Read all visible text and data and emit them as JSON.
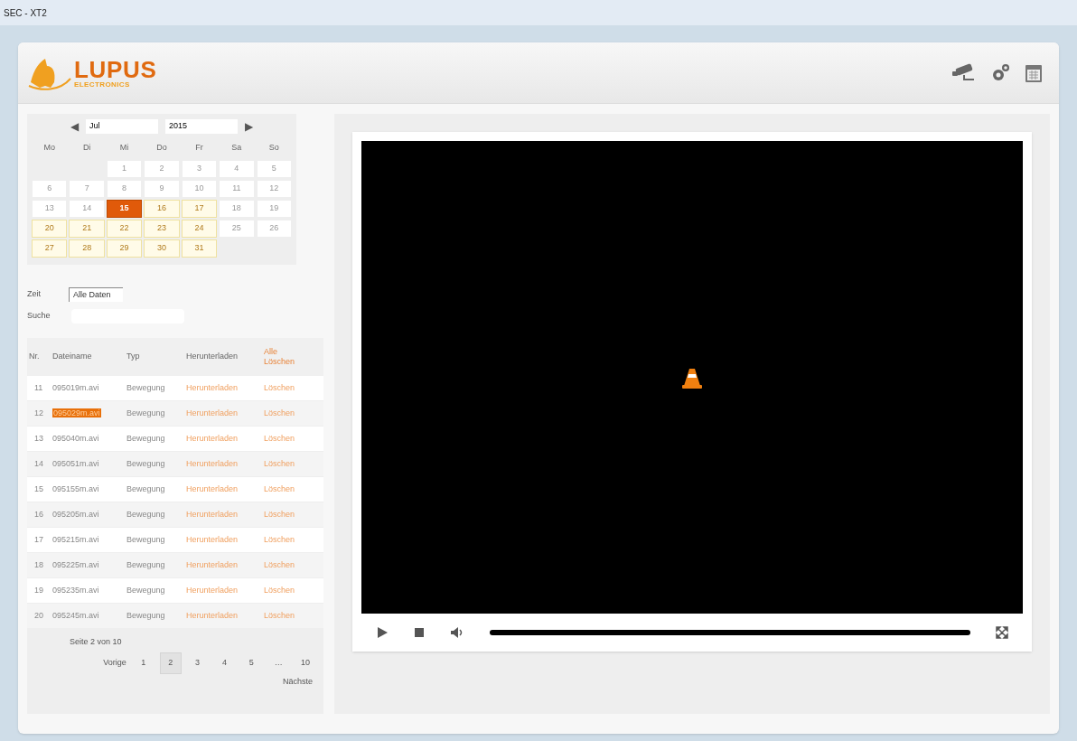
{
  "window": {
    "title": "SEC - XT2"
  },
  "logo": {
    "name": "LUPUS",
    "subtitle": "ELECTRONICS"
  },
  "calendar": {
    "month": "Jul",
    "year": "2015",
    "prev": "◀",
    "next": "▶",
    "weekdays": [
      "Mo",
      "Di",
      "Mi",
      "Do",
      "Fr",
      "Sa",
      "So"
    ],
    "days": [
      {
        "label": "1",
        "has_data": false,
        "selected": false
      },
      {
        "label": "2",
        "has_data": false,
        "selected": false
      },
      {
        "label": "3",
        "has_data": false,
        "selected": false
      },
      {
        "label": "4",
        "has_data": false,
        "selected": false
      },
      {
        "label": "5",
        "has_data": false,
        "selected": false
      },
      {
        "label": "6",
        "has_data": false,
        "selected": false
      },
      {
        "label": "7",
        "has_data": false,
        "selected": false
      },
      {
        "label": "8",
        "has_data": false,
        "selected": false
      },
      {
        "label": "9",
        "has_data": false,
        "selected": false
      },
      {
        "label": "10",
        "has_data": false,
        "selected": false
      },
      {
        "label": "11",
        "has_data": false,
        "selected": false
      },
      {
        "label": "12",
        "has_data": false,
        "selected": false
      },
      {
        "label": "13",
        "has_data": false,
        "selected": false
      },
      {
        "label": "14",
        "has_data": false,
        "selected": false
      },
      {
        "label": "15",
        "has_data": true,
        "selected": true
      },
      {
        "label": "16",
        "has_data": true,
        "selected": false
      },
      {
        "label": "17",
        "has_data": true,
        "selected": false
      },
      {
        "label": "18",
        "has_data": false,
        "selected": false
      },
      {
        "label": "19",
        "has_data": false,
        "selected": false
      },
      {
        "label": "20",
        "has_data": true,
        "selected": false
      },
      {
        "label": "21",
        "has_data": true,
        "selected": false
      },
      {
        "label": "22",
        "has_data": true,
        "selected": false
      },
      {
        "label": "23",
        "has_data": true,
        "selected": false
      },
      {
        "label": "24",
        "has_data": true,
        "selected": false
      },
      {
        "label": "25",
        "has_data": false,
        "selected": false
      },
      {
        "label": "26",
        "has_data": false,
        "selected": false
      },
      {
        "label": "27",
        "has_data": true,
        "selected": false
      },
      {
        "label": "28",
        "has_data": true,
        "selected": false
      },
      {
        "label": "29",
        "has_data": true,
        "selected": false
      },
      {
        "label": "30",
        "has_data": true,
        "selected": false
      },
      {
        "label": "31",
        "has_data": true,
        "selected": false
      }
    ]
  },
  "filters": {
    "time_label": "Zeit",
    "time_value": "Alle Daten",
    "search_label": "Suche"
  },
  "table": {
    "columns": [
      "Nr.",
      "Dateiname",
      "Typ",
      "Herunterladen",
      "Alle Löschen"
    ],
    "rows": [
      {
        "nr": "11",
        "file": "095019m.avi",
        "type": "Bewegung",
        "download": "Herunterladen",
        "delete": "Löschen",
        "selected": false
      },
      {
        "nr": "12",
        "file": "095029m.avi",
        "type": "Bewegung",
        "download": "Herunterladen",
        "delete": "Löschen",
        "selected": true
      },
      {
        "nr": "13",
        "file": "095040m.avi",
        "type": "Bewegung",
        "download": "Herunterladen",
        "delete": "Löschen",
        "selected": false
      },
      {
        "nr": "14",
        "file": "095051m.avi",
        "type": "Bewegung",
        "download": "Herunterladen",
        "delete": "Löschen",
        "selected": false
      },
      {
        "nr": "15",
        "file": "095155m.avi",
        "type": "Bewegung",
        "download": "Herunterladen",
        "delete": "Löschen",
        "selected": false
      },
      {
        "nr": "16",
        "file": "095205m.avi",
        "type": "Bewegung",
        "download": "Herunterladen",
        "delete": "Löschen",
        "selected": false
      },
      {
        "nr": "17",
        "file": "095215m.avi",
        "type": "Bewegung",
        "download": "Herunterladen",
        "delete": "Löschen",
        "selected": false
      },
      {
        "nr": "18",
        "file": "095225m.avi",
        "type": "Bewegung",
        "download": "Herunterladen",
        "delete": "Löschen",
        "selected": false
      },
      {
        "nr": "19",
        "file": "095235m.avi",
        "type": "Bewegung",
        "download": "Herunterladen",
        "delete": "Löschen",
        "selected": false
      },
      {
        "nr": "20",
        "file": "095245m.avi",
        "type": "Bewegung",
        "download": "Herunterladen",
        "delete": "Löschen",
        "selected": false
      }
    ]
  },
  "pagination": {
    "info": "Seite 2 von 10",
    "prev": "Vorige",
    "next": "Nächste",
    "pages": [
      {
        "label": "1",
        "selected": false
      },
      {
        "label": "2",
        "selected": true
      },
      {
        "label": "3",
        "selected": false
      },
      {
        "label": "4",
        "selected": false
      },
      {
        "label": "5",
        "selected": false
      },
      {
        "label": "…",
        "selected": false
      },
      {
        "label": "10",
        "selected": false
      }
    ]
  }
}
